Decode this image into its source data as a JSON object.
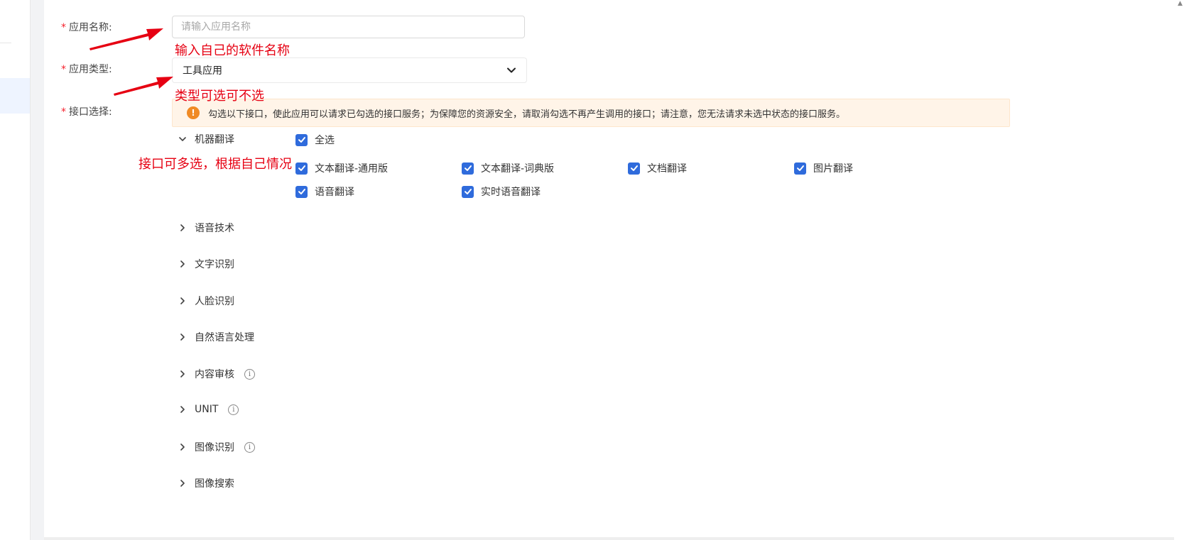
{
  "form": {
    "required_mark": "*",
    "app_name": {
      "label": "应用名称:",
      "placeholder": "请输入应用名称",
      "value": ""
    },
    "app_type": {
      "label": "应用类型:",
      "selected": "工具应用"
    },
    "api_select": {
      "label": "接口选择:"
    }
  },
  "alert": {
    "icon": "warning-icon",
    "text": "勾选以下接口，使此应用可以请求已勾选的接口服务；为保障您的资源安全，请取消勾选不再产生调用的接口；请注意，您无法请求未选中状态的接口服务。"
  },
  "annotations": {
    "name": "输入自己的软件名称",
    "type": "类型可选可不选",
    "api": "接口可多选，根据自己情况",
    "color": "#e60012"
  },
  "machine_translation": {
    "label": "机器翻译",
    "expanded": true,
    "select_all": {
      "label": "全选",
      "checked": true
    },
    "options": [
      {
        "label": "文本翻译-通用版",
        "checked": true
      },
      {
        "label": "文本翻译-词典版",
        "checked": true
      },
      {
        "label": "文档翻译",
        "checked": true
      },
      {
        "label": "图片翻译",
        "checked": true
      },
      {
        "label": "语音翻译",
        "checked": true
      },
      {
        "label": "实时语音翻译",
        "checked": true
      }
    ]
  },
  "categories": [
    {
      "label": "语音技术",
      "info": false
    },
    {
      "label": "文字识别",
      "info": false
    },
    {
      "label": "人脸识别",
      "info": false
    },
    {
      "label": "自然语言处理",
      "info": false
    },
    {
      "label": "内容审核",
      "info": true
    },
    {
      "label": "UNIT",
      "info": true
    },
    {
      "label": "图像识别",
      "info": true
    },
    {
      "label": "图像搜索",
      "info": false
    }
  ],
  "colors": {
    "checkbox": "#2f6bdc",
    "required": "#f5222d",
    "alert_bg": "#fff4e8",
    "warning": "#f08a24"
  }
}
